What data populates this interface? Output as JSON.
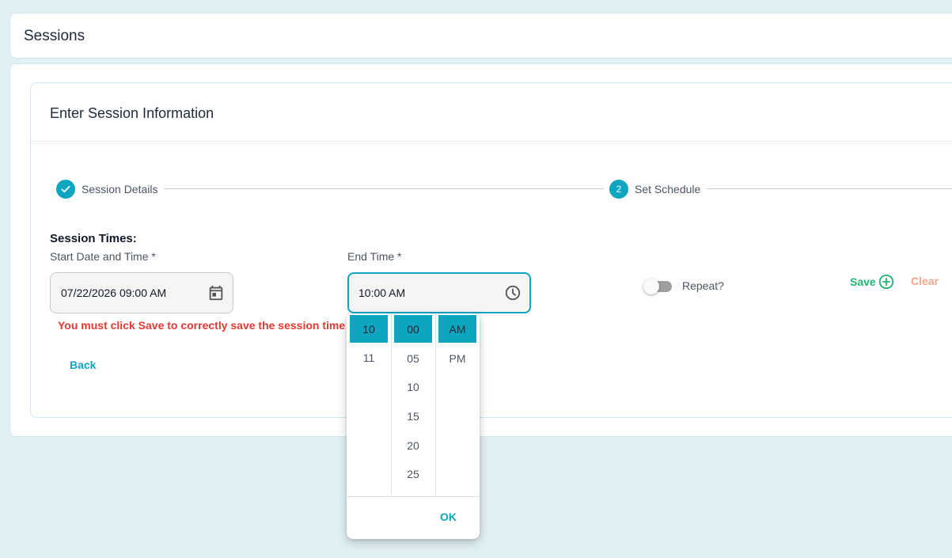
{
  "page": {
    "title": "Sessions"
  },
  "form": {
    "title": "Enter Session Information",
    "steps": [
      {
        "label": "Session Details",
        "status": "completed",
        "icon": "check-icon"
      },
      {
        "label": "Set Schedule",
        "status": "active",
        "number": "2"
      }
    ],
    "section_label": "Session Times:",
    "start": {
      "label": "Start Date and Time *",
      "value": "07/22/2026 09:00 AM",
      "icon": "calendar-icon"
    },
    "end": {
      "label": "End Time *",
      "value": "10:00 AM",
      "icon": "clock-icon"
    },
    "warning": "You must click Save to correctly save the session time or an",
    "repeat_label": "Repeat?",
    "save_label": "Save",
    "clear_label": "Clear",
    "back_label": "Back"
  },
  "time_picker": {
    "hours": [
      "10",
      "11"
    ],
    "minutes": [
      "00",
      "05",
      "10",
      "15",
      "20",
      "25"
    ],
    "meridiem": [
      "AM",
      "PM"
    ],
    "selected": {
      "hour": "10",
      "minute": "00",
      "meridiem": "AM"
    },
    "ok_label": "OK"
  },
  "colors": {
    "accent": "#0ea5c0",
    "warning": "#e53935",
    "save": "#22b573",
    "clear": "#f4a58a",
    "background": "#e1f0f4"
  }
}
